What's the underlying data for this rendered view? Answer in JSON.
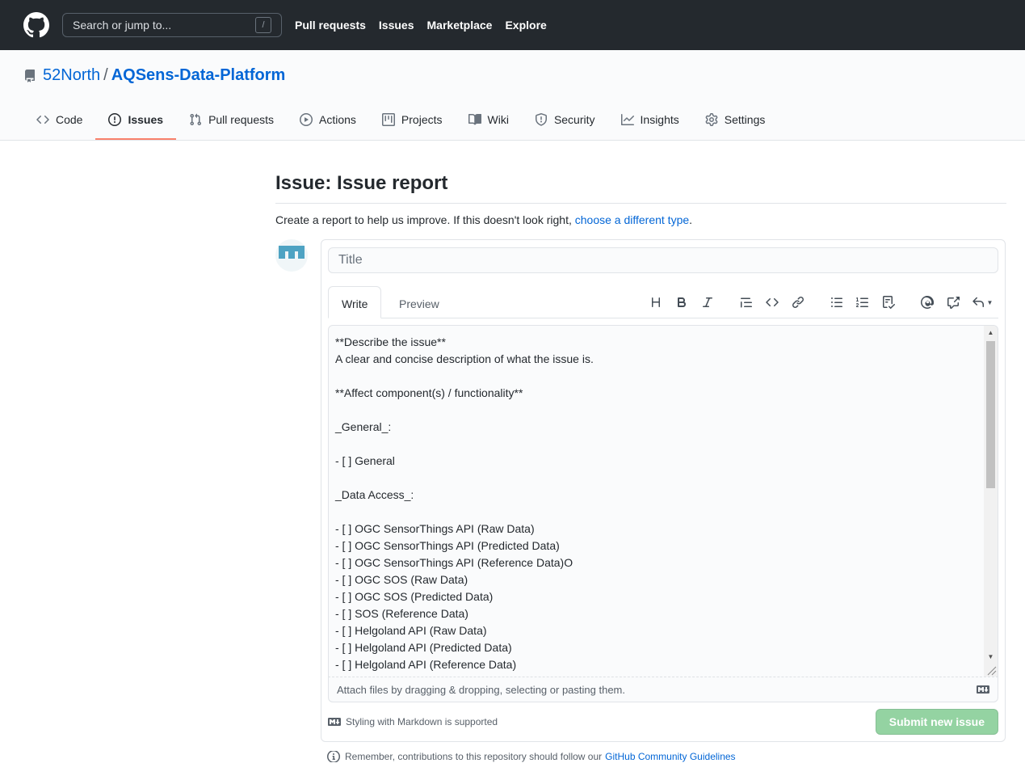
{
  "header": {
    "search_placeholder": "Search or jump to...",
    "search_shortcut": "/",
    "nav": [
      "Pull requests",
      "Issues",
      "Marketplace",
      "Explore"
    ]
  },
  "repo": {
    "owner": "52North",
    "separator": "/",
    "name": "AQSens-Data-Platform",
    "tabs": [
      "Code",
      "Issues",
      "Pull requests",
      "Actions",
      "Projects",
      "Wiki",
      "Security",
      "Insights",
      "Settings"
    ],
    "active_tab": "Issues"
  },
  "issue_form": {
    "page_title": "Issue: Issue report",
    "desc_prefix": "Create a report to help us improve. If this doesn't look right,",
    "desc_link": "choose a different type",
    "desc_suffix": ".",
    "title_placeholder": "Title",
    "write_tab": "Write",
    "preview_tab": "Preview",
    "body": "**Describe the issue**\nA clear and concise description of what the issue is.\n\n**Affect component(s) / functionality**\n\n_General_:\n\n- [ ] General\n\n_Data Access_:\n\n- [ ] OGC SensorThings API (Raw Data)\n- [ ] OGC SensorThings API (Predicted Data)\n- [ ] OGC SensorThings API (Reference Data)O\n- [ ] OGC SOS (Raw Data)\n- [ ] OGC SOS (Predicted Data)\n- [ ] SOS (Reference Data)\n- [ ] Helgoland API (Raw Data)\n- [ ] Helgoland API (Predicted Data)\n- [ ] Helgoland API (Reference Data)",
    "attach_text": "Attach files by dragging & dropping, selecting or pasting them.",
    "markdown_note": "Styling with Markdown is supported",
    "submit_label": "Submit new issue",
    "remember_text": "Remember, contributions to this repository should follow our",
    "remember_link": "GitHub Community Guidelines"
  },
  "colors": {
    "header_bg": "#24292e",
    "link": "#0366d6",
    "active_tab_border": "#f9826c",
    "submit_disabled": "#94d3a2"
  }
}
